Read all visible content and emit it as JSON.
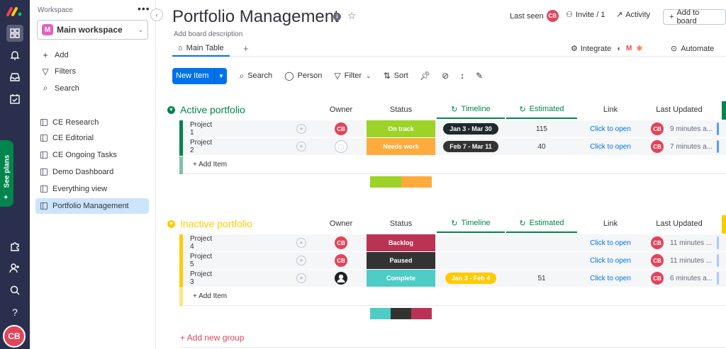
{
  "rail": {
    "items": [
      "grid-icon",
      "bell-icon",
      "inbox-icon",
      "calendar-icon"
    ],
    "see_plans": "See plans",
    "bottom": [
      "puzzle-icon",
      "add-user-icon",
      "search-icon",
      "help-icon"
    ],
    "avatar": "CB"
  },
  "sidebar": {
    "workspace_label": "Workspace",
    "workspace_badge": "M",
    "workspace_name": "Main workspace",
    "actions": {
      "add": "Add",
      "filters": "Filters",
      "search": "Search"
    },
    "boards": [
      "CE Research",
      "CE Editorial",
      "CE Ongoing Tasks",
      "Demo Dashboard",
      "Everything view",
      "Portfolio Management"
    ]
  },
  "header": {
    "title": "Portfolio Management",
    "description": "Add board description",
    "last_seen": "Last seen",
    "last_seen_avatar": "CB",
    "invite": "Invite / 1",
    "activity": "Activity",
    "add_to_board": "Add to board"
  },
  "tabs": {
    "main": "Main Table",
    "plus": "+",
    "integrate": "Integrate",
    "automate": "Automate"
  },
  "toolbar": {
    "new_item": "New Item",
    "search": "Search",
    "person": "Person",
    "filter": "Filter",
    "sort": "Sort"
  },
  "columns": {
    "owner": "Owner",
    "status": "Status",
    "timeline": "Timeline",
    "estimated": "Estimated",
    "link": "Link",
    "last_updated": "Last Updated"
  },
  "groups": [
    {
      "name": "Active portfolio",
      "color": "#00854d",
      "rows": [
        {
          "name": "Project 1",
          "owner": "CB",
          "status": "On track",
          "status_color": "#9cd326",
          "timeline": "Jan 3 - Mar 30",
          "timeline_color": "#1f2a2e",
          "estimated": "115",
          "link": "Click to open",
          "updated_by": "CB",
          "updated": "9 minutes a..."
        },
        {
          "name": "Project 2",
          "owner": "",
          "status": "Needs work",
          "status_color": "#fdab3d",
          "timeline": "Feb 7 - Mar 11",
          "timeline_color": "#333333",
          "estimated": "40",
          "link": "Click to open",
          "updated_by": "CB",
          "updated": "7 minutes a..."
        }
      ],
      "add_item": "+ Add Item",
      "summary": [
        {
          "color": "#9cd326",
          "share": 0.5
        },
        {
          "color": "#fdab3d",
          "share": 0.5
        }
      ]
    },
    {
      "name": "Inactive portfolio",
      "color": "#ffcb00",
      "rows": [
        {
          "name": "Project 4",
          "owner": "CB",
          "status": "Backlog",
          "status_color": "#bb3354",
          "timeline": "",
          "timeline_color": "",
          "estimated": "",
          "link": "Click to open",
          "updated_by": "CB",
          "updated": "11 minutes ..."
        },
        {
          "name": "Project 5",
          "owner": "CB",
          "status": "Paused",
          "status_color": "#333333",
          "timeline": "",
          "timeline_color": "",
          "estimated": "",
          "link": "Click to open",
          "updated_by": "CB",
          "updated": "11 minutes ..."
        },
        {
          "name": "Project 3",
          "owner": "",
          "status": "Complete",
          "status_color": "#4eccc6",
          "timeline": "Jan 3 - Feb 4",
          "timeline_color": "#ffcb00",
          "estimated": "51",
          "link": "Click to open",
          "updated_by": "CB",
          "updated": "6 minutes a..."
        }
      ],
      "add_item": "+ Add Item",
      "summary": [
        {
          "color": "#4eccc6",
          "share": 0.3333
        },
        {
          "color": "#333333",
          "share": 0.3333
        },
        {
          "color": "#bb3354",
          "share": 0.3334
        }
      ]
    }
  ],
  "add_new_group": "+ Add new group"
}
